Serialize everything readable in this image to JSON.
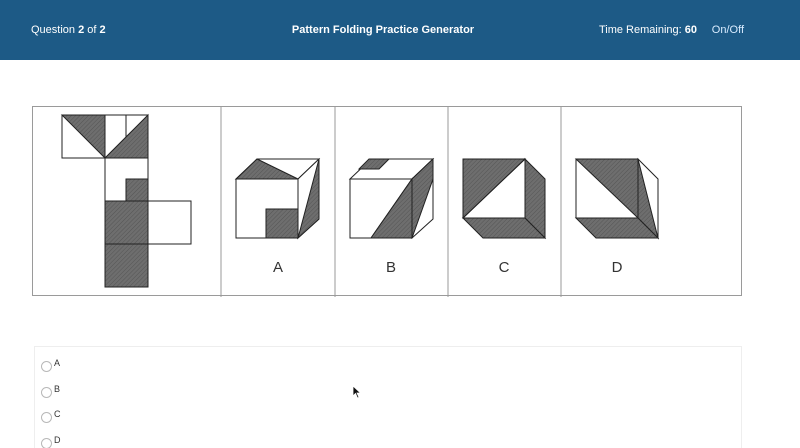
{
  "header": {
    "question_prefix": "Question ",
    "question_current": "2",
    "question_of": " of ",
    "question_total": "2",
    "title": "Pattern Folding Practice Generator",
    "time_label": "Time Remaining: ",
    "time_value": "60",
    "toggle_label": "On/Off",
    "bg_color": "#1d5a86"
  },
  "puzzle": {
    "options": [
      "A",
      "B",
      "C",
      "D"
    ],
    "fill_color": "#6e6e6e",
    "line_color": "#222222"
  },
  "answers": {
    "choices": [
      "A",
      "B",
      "C",
      "D"
    ],
    "selected": null
  }
}
